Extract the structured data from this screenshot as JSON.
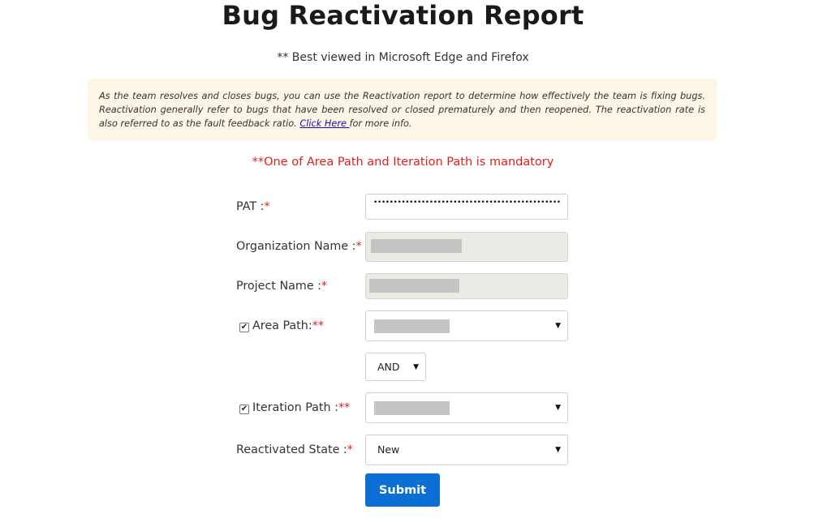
{
  "header": {
    "title": "Bug Reactivation Report",
    "subtitle": "** Best viewed in Microsoft Edge and Firefox"
  },
  "info": {
    "text": "As the team resolves and closes bugs, you can use the Reactivation report to determine how effectively the team is fixing bugs. Reactivation generally refer to bugs that have been resolved or closed prematurely and then reopened. The reactivation rate is also referred to as the fault feedback ratio. ",
    "link_text": "Click Here ",
    "suffix": "for more info."
  },
  "mandatory_note": "**One of Area Path and Iteration Path is mandatory",
  "form": {
    "pat": {
      "label": "PAT :",
      "required": "*",
      "value": "••••••••••••••••••••••••••••••••••••••••••••••••••••"
    },
    "organization": {
      "label": "Organization Name :",
      "required": "*"
    },
    "project": {
      "label": "Project Name :",
      "required": "*"
    },
    "area_path": {
      "label": "Area Path:",
      "required": "**",
      "checked": true
    },
    "operator": {
      "value": "AND"
    },
    "iteration_path": {
      "label": "Iteration Path :",
      "required": "**",
      "checked": true
    },
    "reactivated_state": {
      "label": "Reactivated State :",
      "required": "*",
      "value": "New"
    },
    "submit_label": "Submit"
  },
  "icons": {
    "checkbox": "checkbox-checked-icon",
    "dropdown": "chevron-down-icon"
  },
  "colors": {
    "accent": "#0b6fd4",
    "required": "#e02020",
    "info_bg": "#fdf5e6",
    "disabled_bg": "#ebeae5"
  }
}
